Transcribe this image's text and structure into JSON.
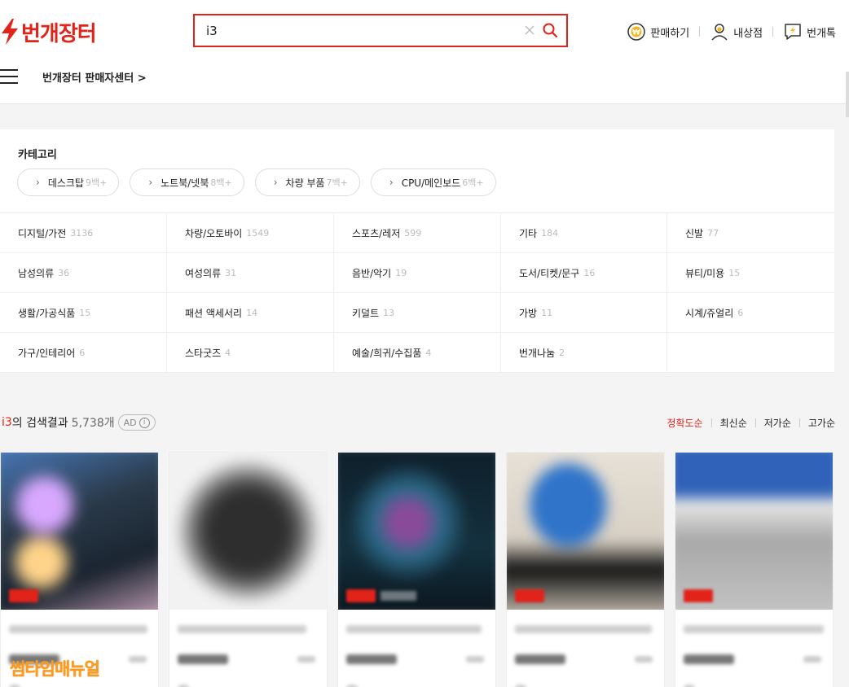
{
  "header": {
    "logo_text": "번개장터",
    "search_value": "i3",
    "menu": [
      {
        "label": "판매하기",
        "icon": "sell-icon"
      },
      {
        "label": "내상점",
        "icon": "profile-icon"
      },
      {
        "label": "번개톡",
        "icon": "chat-icon"
      }
    ],
    "seller_center": "번개장터 판매자센터 >"
  },
  "categories": {
    "title": "카테고리",
    "chips": [
      {
        "label": "데스크탑",
        "count": "9백+"
      },
      {
        "label": "노트북/넷북",
        "count": "8백+"
      },
      {
        "label": "차량 부품",
        "count": "7백+"
      },
      {
        "label": "CPU/메인보드",
        "count": "6백+"
      }
    ],
    "grid": [
      {
        "label": "디지털/가전",
        "count": "3136"
      },
      {
        "label": "차량/오토바이",
        "count": "1549"
      },
      {
        "label": "스포츠/레저",
        "count": "599"
      },
      {
        "label": "기타",
        "count": "184"
      },
      {
        "label": "신발",
        "count": "77"
      },
      {
        "label": "남성의류",
        "count": "36"
      },
      {
        "label": "여성의류",
        "count": "31"
      },
      {
        "label": "음반/악기",
        "count": "19"
      },
      {
        "label": "도서/티켓/문구",
        "count": "16"
      },
      {
        "label": "뷰티/미용",
        "count": "15"
      },
      {
        "label": "생활/가공식품",
        "count": "15"
      },
      {
        "label": "패션 액세서리",
        "count": "14"
      },
      {
        "label": "키덜트",
        "count": "13"
      },
      {
        "label": "가방",
        "count": "11"
      },
      {
        "label": "시계/쥬얼리",
        "count": "6"
      },
      {
        "label": "가구/인테리어",
        "count": "6"
      },
      {
        "label": "스타굿즈",
        "count": "4"
      },
      {
        "label": "예술/희귀/수집품",
        "count": "4"
      },
      {
        "label": "번개나눔",
        "count": "2"
      }
    ]
  },
  "results": {
    "keyword": "i3",
    "suffix": "의 검색결과",
    "count": "5,738개",
    "ad_label": "AD",
    "ad_info": "i",
    "sort": [
      "정확도순",
      "최신순",
      "저가순",
      "고가순"
    ],
    "active_sort": "정확도순"
  },
  "products": [
    {
      "thumb": "blurred-product-photo",
      "colors": [
        "#2a3a4a",
        "#5b8fd0",
        "#c7a2b8"
      ]
    },
    {
      "thumb": "blurred-product-photo",
      "colors": [
        "#f2f2f2",
        "#2e2e2e",
        "#555555"
      ]
    },
    {
      "thumb": "blurred-product-photo",
      "colors": [
        "#0e1e2a",
        "#2d6b8a",
        "#8a4a9a"
      ]
    },
    {
      "thumb": "blurred-product-photo",
      "colors": [
        "#d8d0c4",
        "#2f74c9",
        "#111111"
      ]
    },
    {
      "thumb": "blurred-product-photo",
      "colors": [
        "#2f62b8",
        "#a8a8a8",
        "#c4c4c4"
      ]
    }
  ],
  "watermark": "썸타임매뉴얼",
  "colors": {
    "accent": "#e2231a",
    "watermark": "#ff9b1a"
  }
}
